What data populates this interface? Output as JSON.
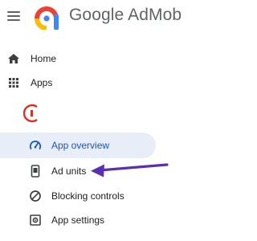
{
  "header": {
    "brand": "Google AdMob",
    "menu_icon": "hamburger-menu-icon",
    "logo_icon": "admob-logo-icon",
    "logo_colors": [
      "#ea4335",
      "#fbbc04",
      "#4285f4"
    ]
  },
  "nav": {
    "home": {
      "label": "Home",
      "icon": "home-icon"
    },
    "apps": {
      "label": "Apps",
      "icon": "apps-grid-icon"
    },
    "app": {
      "icon": "app-icon",
      "name": ""
    },
    "app_overview": {
      "label": "App overview",
      "icon": "gauge-icon",
      "selected": true
    },
    "ad_units": {
      "label": "Ad units",
      "icon": "phone-icon"
    },
    "blocking_controls": {
      "label": "Blocking controls",
      "icon": "block-icon"
    },
    "app_settings": {
      "label": "App settings",
      "icon": "settings-icon"
    }
  },
  "annotation": {
    "icon": "pointer-arrow-icon",
    "color": "#5b2fb5"
  },
  "colors": {
    "selected_bg": "#e8eef8",
    "selected_text": "#1a56c2",
    "icon": "#3c4043"
  }
}
